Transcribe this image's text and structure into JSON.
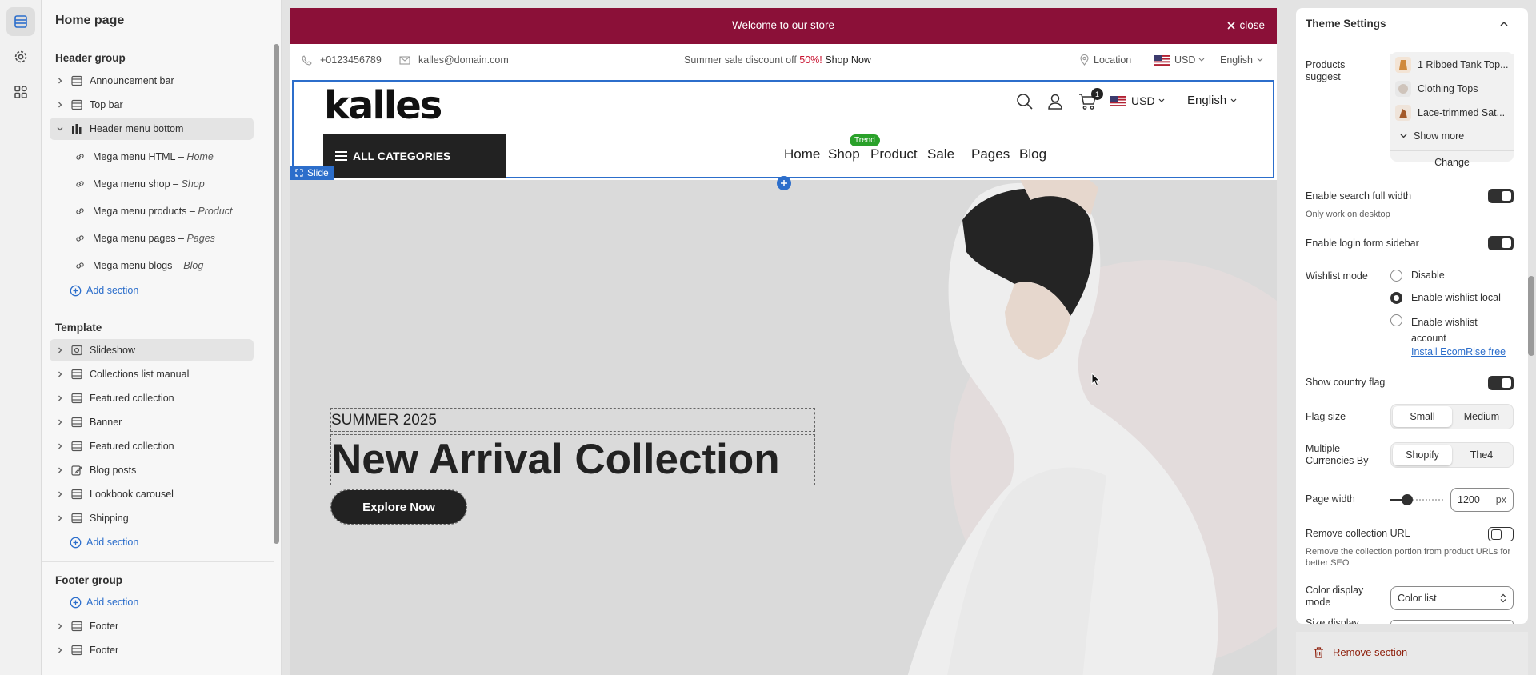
{
  "left_panel": {
    "title": "Home page",
    "header_group": {
      "label": "Header group",
      "items": [
        "Announcement bar",
        "Top bar",
        "Header menu bottom"
      ],
      "children": [
        {
          "label": "Mega menu HTML",
          "sep": " – ",
          "target": "Home"
        },
        {
          "label": "Mega menu shop",
          "sep": " – ",
          "target": "Shop"
        },
        {
          "label": "Mega menu products",
          "sep": " – ",
          "target": "Product"
        },
        {
          "label": "Mega menu pages",
          "sep": " – ",
          "target": "Pages"
        },
        {
          "label": "Mega menu blogs",
          "sep": " – ",
          "target": "Blog"
        }
      ],
      "add_label": "Add section"
    },
    "template": {
      "label": "Template",
      "items": [
        "Slideshow",
        "Collections list manual",
        "Featured collection",
        "Banner",
        "Featured collection",
        "Blog posts",
        "Lookbook carousel",
        "Shipping"
      ],
      "add_label": "Add section"
    },
    "footer_group": {
      "label": "Footer group",
      "add_label": "Add section",
      "items": [
        "Footer",
        "Footer"
      ]
    }
  },
  "preview": {
    "announcement": {
      "text": "Welcome to our store",
      "close": "close"
    },
    "topbar": {
      "phone": "+0123456789",
      "email": "kalles@domain.com",
      "promo_prefix": "Summer sale discount off ",
      "promo_highlight": "50%!",
      "promo_link": "Shop Now",
      "location": "Location",
      "currency": "USD",
      "language": "English"
    },
    "header": {
      "logo": "kalles",
      "categories": "ALL CATEGORIES",
      "nav": [
        "Home",
        "Shop",
        "Product",
        "Sale",
        "Pages",
        "Blog"
      ],
      "trend_badge": "Trend",
      "cart_count": "1",
      "currency": "USD",
      "language": "English"
    },
    "section_tag": "Slide",
    "hero": {
      "eyebrow": "SUMMER 2025",
      "title": "New Arrival Collection",
      "button": "Explore Now"
    }
  },
  "right_panel": {
    "title": "Theme Settings",
    "products_suggest": {
      "label": "Products suggest",
      "items": [
        "1 Ribbed Tank Top...",
        "Clothing Tops",
        "Lace-trimmed Sat..."
      ],
      "show_more": "Show more",
      "change": "Change"
    },
    "search_full_width": {
      "label": "Enable search full width",
      "help": "Only work on desktop",
      "on": true
    },
    "login_sidebar": {
      "label": "Enable login form sidebar",
      "on": true
    },
    "wishlist": {
      "label": "Wishlist mode",
      "options": [
        "Disable",
        "Enable wishlist local",
        "Enable wishlist account"
      ],
      "selected": "Enable wishlist local",
      "link": "Install EcomRise free"
    },
    "country_flag": {
      "label": "Show country flag",
      "on": true
    },
    "flag_size": {
      "label": "Flag size",
      "options": [
        "Small",
        "Medium"
      ],
      "selected": "Small"
    },
    "currencies_by": {
      "label": "Multiple Currencies By",
      "options": [
        "Shopify",
        "The4"
      ],
      "selected": "Shopify"
    },
    "page_width": {
      "label": "Page width",
      "value": "1200",
      "unit": "px"
    },
    "remove_collection_url": {
      "label": "Remove collection URL",
      "help": "Remove the collection portion from product URLs for better SEO",
      "on": false
    },
    "color_display": {
      "label": "Color display mode",
      "value": "Color list"
    },
    "size_display_partial": "Size display",
    "remove_section": "Remove section"
  },
  "colors": {
    "announcement_bg": "#8b1038",
    "accent_blue": "#2c6ecb",
    "promo_red": "#c8102e",
    "trend_green": "#2aa12a"
  }
}
